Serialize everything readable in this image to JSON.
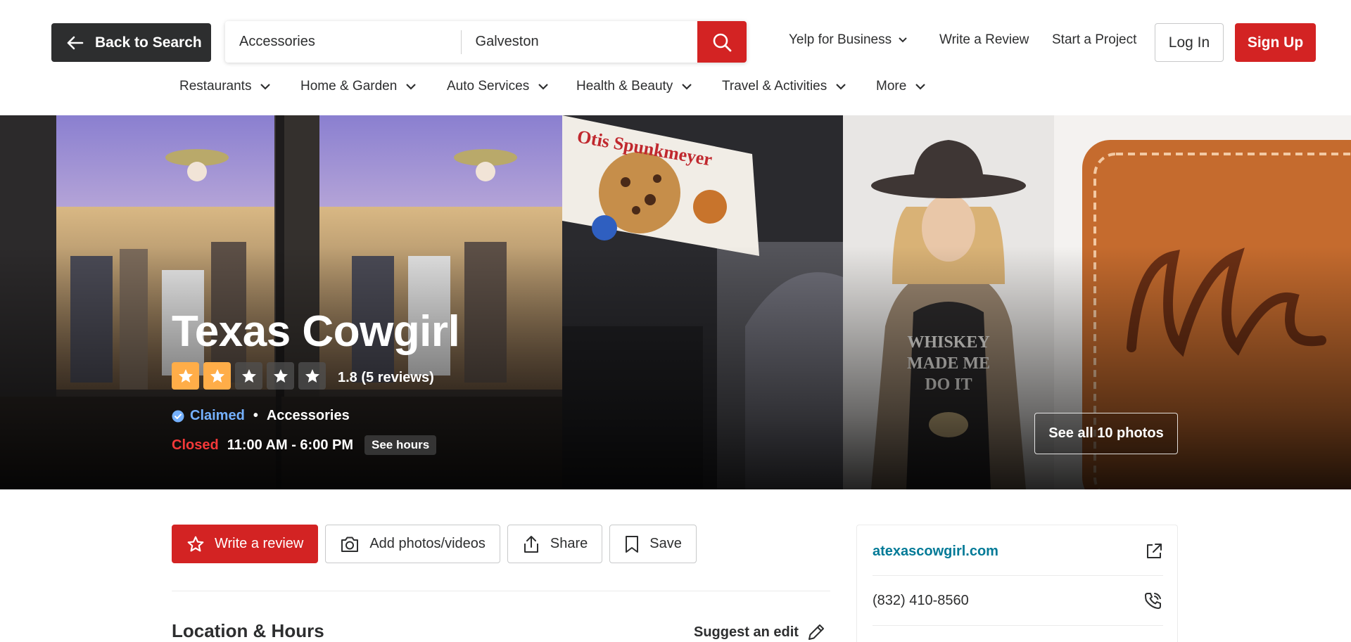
{
  "header": {
    "back_label": "Back to Search",
    "search_what_value": "Accessories",
    "search_where_value": "Galveston",
    "yelp_for_business": "Yelp for Business",
    "write_review": "Write a Review",
    "start_project": "Start a Project",
    "login": "Log In",
    "signup": "Sign Up"
  },
  "categories": [
    {
      "label": "Restaurants"
    },
    {
      "label": "Home & Garden"
    },
    {
      "label": "Auto Services"
    },
    {
      "label": "Health & Beauty"
    },
    {
      "label": "Travel & Activities"
    },
    {
      "label": "More"
    }
  ],
  "business": {
    "name": "Texas Cowgirl",
    "rating": 1.8,
    "rating_text": "1.8 (5 reviews)",
    "stars_filled": 2,
    "stars_total": 5,
    "claimed": "Claimed",
    "separator": "•",
    "category": "Accessories",
    "status": "Closed",
    "hours": "11:00 AM - 6:00 PM",
    "see_hours": "See hours",
    "see_photos": "See all 10 photos"
  },
  "photos": {
    "sign_text": "Otis Spunkmeyer",
    "shirt_line1": "WHISKEY",
    "shirt_line2": "MADE ME",
    "shirt_line3": "DO IT"
  },
  "actions": {
    "write_review": "Write a review",
    "add_photos": "Add photos/videos",
    "share": "Share",
    "save": "Save"
  },
  "location": {
    "title": "Location & Hours",
    "suggest_edit": "Suggest an edit"
  },
  "sidebar": {
    "website": "atexascowgirl.com",
    "phone": "(832) 410-8560"
  },
  "colors": {
    "brand_red": "#d32323",
    "star_orange": "#ffad48",
    "link_teal": "#027a97",
    "claimed_blue": "#75b1ff"
  }
}
